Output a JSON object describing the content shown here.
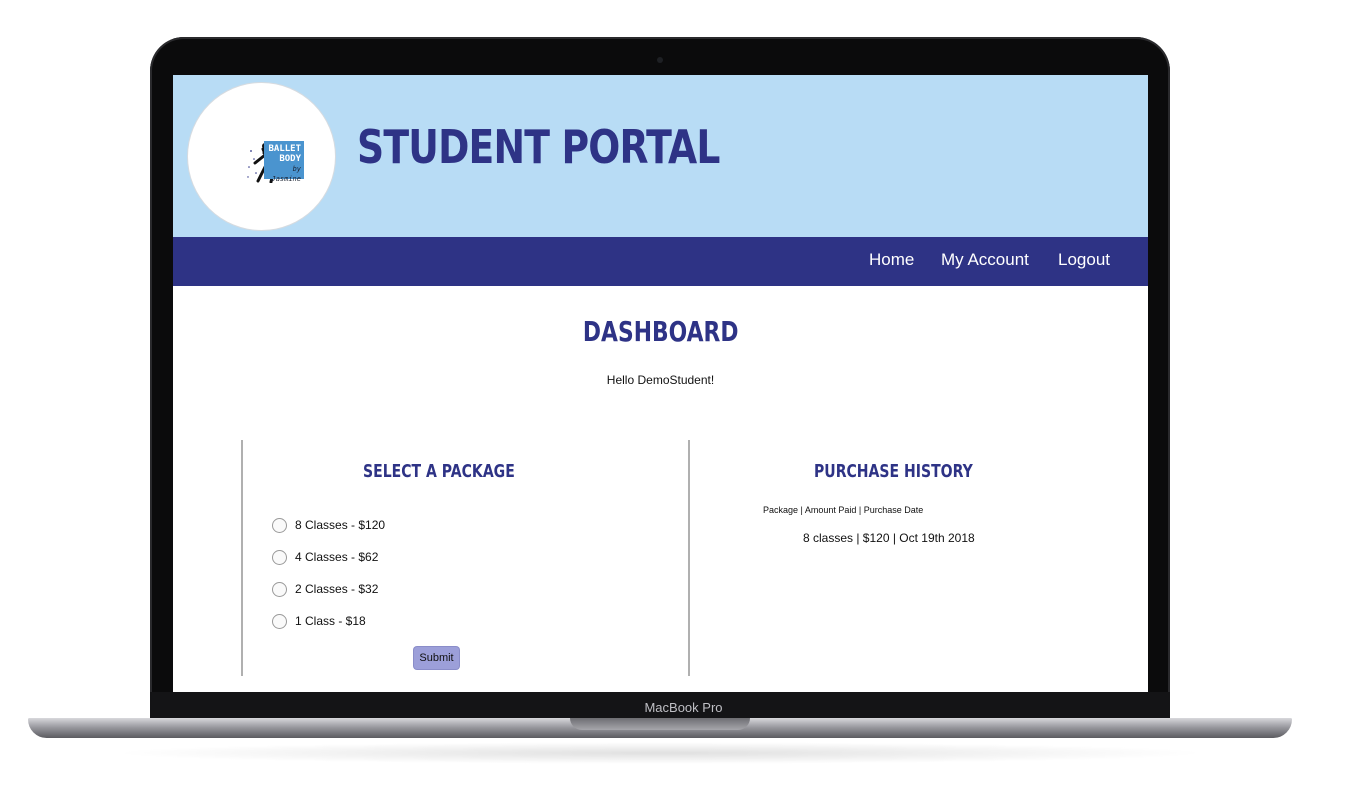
{
  "device": {
    "label": "MacBook Pro"
  },
  "header": {
    "logo": {
      "line1": "BALLET",
      "line2": "BODY",
      "line3": "by Jasmine"
    },
    "title": "STUDENT PORTAL"
  },
  "nav": {
    "items": [
      {
        "label": "Home"
      },
      {
        "label": "My Account"
      },
      {
        "label": "Logout"
      }
    ]
  },
  "main": {
    "title": "DASHBOARD",
    "greeting": "Hello DemoStudent!"
  },
  "packages": {
    "title": "SELECT A PACKAGE",
    "options": [
      {
        "label": "8 Classes - $120"
      },
      {
        "label": "4 Classes - $62"
      },
      {
        "label": "2 Classes - $32"
      },
      {
        "label": "1 Class - $18"
      }
    ],
    "submit_label": "Submit"
  },
  "history": {
    "title": "PURCHASE HISTORY",
    "header": "Package | Amount Paid | Purchase Date",
    "rows": [
      {
        "text": "8 classes | $120 | Oct 19th 2018"
      }
    ]
  },
  "colors": {
    "header_bg": "#b8dcf5",
    "nav_bg": "#2e3385",
    "title_color": "#2e3386",
    "submit_bg": "#9c9fd9"
  }
}
